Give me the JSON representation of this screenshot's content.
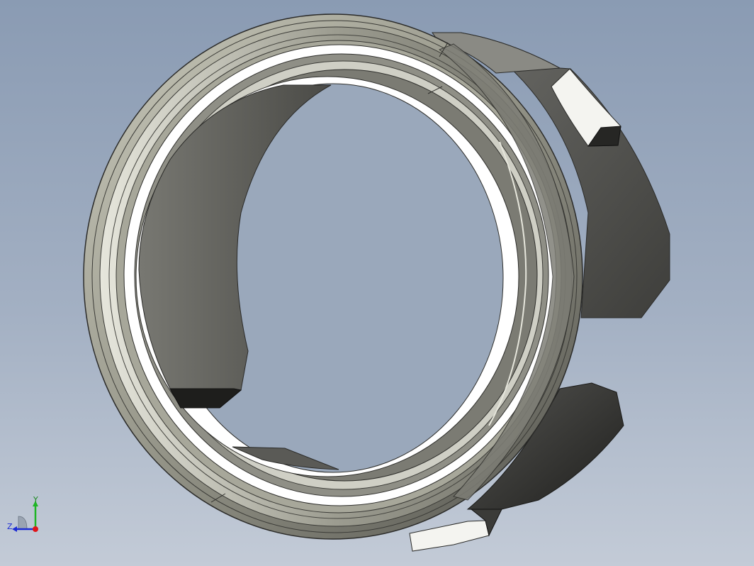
{
  "viewport": {
    "scene": "bearing-adapter-sleeve-model"
  },
  "triad": {
    "x_label": "",
    "y_label": "Y",
    "z_label": "Z",
    "colors": {
      "y_axis": "#1fb526",
      "z_axis": "#1c2bd4",
      "x_axis": "#e0141a"
    }
  },
  "colors": {
    "background_top": "#8a9bb3",
    "background_bottom": "#c3cbd7",
    "metal_light": "#b9b9ab",
    "metal_dark": "#4b4b46",
    "inner_face": "#ffffff"
  }
}
